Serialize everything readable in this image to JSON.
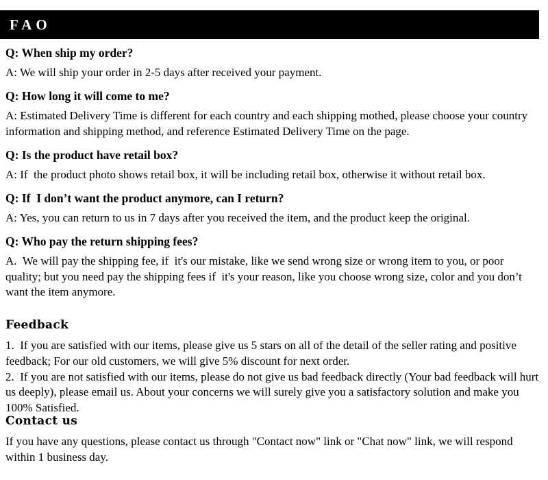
{
  "header": {
    "title": "FAO",
    "background_color": "#000000",
    "text_color": "#ffffff"
  },
  "faq": {
    "items": [
      {
        "question": "Q: When ship my order?",
        "answer": "A: We will ship your order in 2-5 days after received your payment."
      },
      {
        "question": "Q: How long it will come to me?",
        "answer": "A: Estimated Delivery Time is different for each country and each shipping mothed, please choose your country information and shipping method, and reference Estimated Delivery Time on the page."
      },
      {
        "question": "Q: Is the product have retail box?",
        "answer": "A: If  the product photo shows retail box, it will be including retail box, otherwise it without retail box."
      },
      {
        "question": "Q: If  I don’t want the product anymore, can I return?",
        "answer": "A: Yes, you can return to us in 7 days after you received the item, and the product keep the original."
      },
      {
        "question": "Q: Who pay the return shipping fees?",
        "answer": "A.  We will pay the shipping fee, if  it's our mistake, like we send wrong size or wrong item to you, or poor quality; but you need pay the shipping fees if  it's your reason, like you choose wrong size, color and you don’t want the item anymore."
      }
    ]
  },
  "feedback": {
    "heading": "Feedback",
    "items": [
      "1.  If you are satisfied with our items, please give us 5 stars on all of the detail of the seller rating and positive feedback; For our old customers, we will give 5% discount for next order.",
      "2.  If you are not satisfied with our items, please do not give us bad feedback directly (Your bad feedback will hurt us deeply), please email us. About your concerns we will surely give you a satisfactory solution and make you 100% Satisfied."
    ]
  },
  "contact": {
    "heading": "Contact us",
    "text": "If you have any questions, please contact us through \"Contact now\" link or \"Chat now\" link, we will respond within 1 business day."
  }
}
